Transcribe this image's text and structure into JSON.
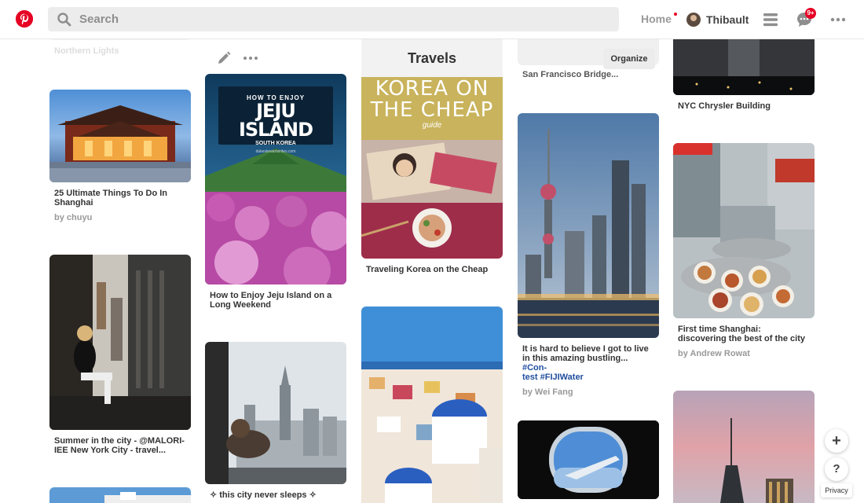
{
  "header": {
    "search_placeholder": "Search",
    "home_label": "Home",
    "user_name": "Thibault",
    "notification_count": "9+"
  },
  "board": {
    "title": "Travels",
    "organize_label": "Organize"
  },
  "pins": {
    "northern_lights": {
      "title": "Northern Lights"
    },
    "shanghai_ultimate": {
      "title": "25 Ultimate Things To Do In Shanghai",
      "by": "by chuyu"
    },
    "summer_city": {
      "title": "Summer in the city - @MALORI-IEE New York City - travel..."
    },
    "jeju": {
      "title": "How to Enjoy Jeju Island on a Long Weekend",
      "poster_line1": "HOW TO ENJOY",
      "poster_line2": "JEJU ISLAND",
      "poster_line3": "SOUTH KOREA",
      "poster_url": "dukestewartwrites.com"
    },
    "never_sleeps": {
      "title": "✧ this city never sleeps ✧"
    },
    "korea_cheap": {
      "title": "Traveling Korea on the Cheap",
      "poster_line1": "KOREA ON",
      "poster_line2": "THE CHEAP",
      "poster_line3": "guide"
    },
    "sf_bridge": {
      "title": "San Francisco Bridge..."
    },
    "bustling": {
      "title_main": "It is hard to believe I got to live in this amazing bustling... ",
      "hashtag1": "#Con-",
      "hashtag2": "test #FIJIWater",
      "by": "by Wei Fang"
    },
    "chrysler": {
      "title": "NYC Chrysler Building"
    },
    "shanghai_food": {
      "title": "First time Shanghai: discovering the best of the city",
      "by": "by Andrew Rowat"
    }
  },
  "floating": {
    "add_label": "+",
    "help_label": "?",
    "privacy_label": "Privacy"
  },
  "colors": {
    "brand": "#e60023",
    "hashtag": "#1f4e9e"
  }
}
